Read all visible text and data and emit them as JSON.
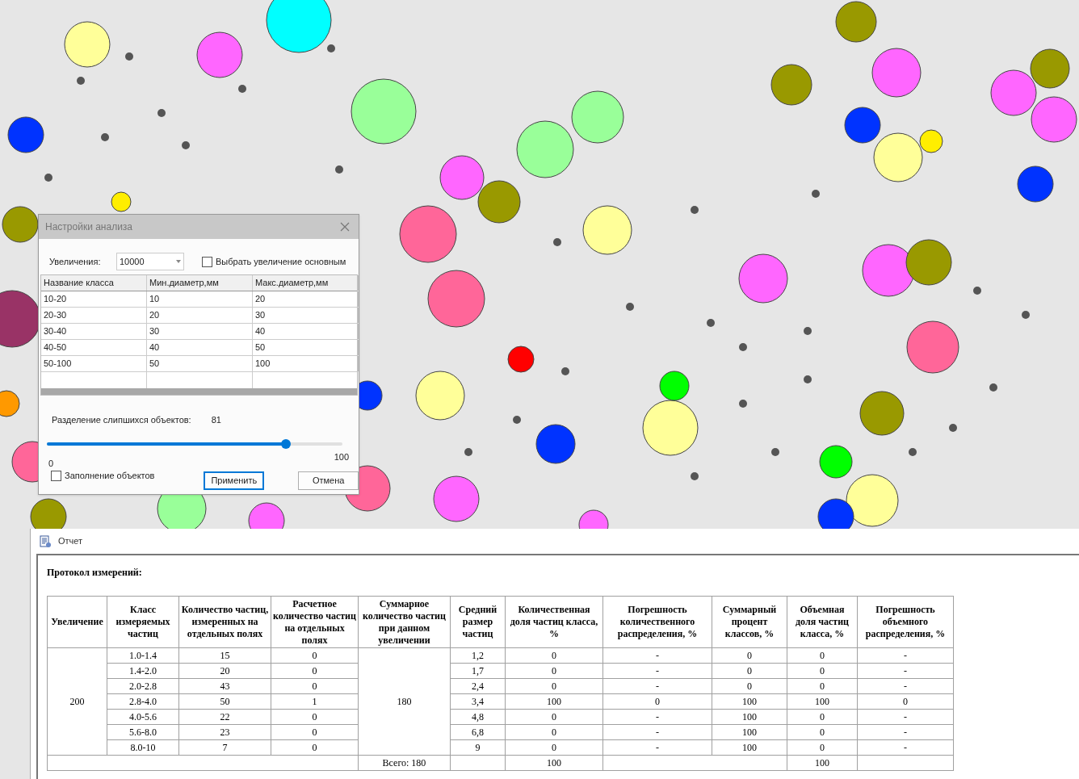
{
  "dialog": {
    "title": "Настройки анализа",
    "magnification_label": "Увеличения:",
    "magnification_value": "10000",
    "main_checkbox": {
      "label": "Выбрать увеличение основным",
      "checked": false
    },
    "class_table": {
      "columns": [
        "Название класса",
        "Мин.диаметр,мм",
        "Макс.диаметр,мм"
      ],
      "rows": [
        [
          "10-20",
          "10",
          "20"
        ],
        [
          "20-30",
          "20",
          "30"
        ],
        [
          "30-40",
          "30",
          "40"
        ],
        [
          "40-50",
          "40",
          "50"
        ],
        [
          "50-100",
          "50",
          "100"
        ]
      ]
    },
    "separation": {
      "label": "Разделение слипшихся объектов:",
      "reading": "81",
      "level": 0.81,
      "min": "0",
      "max": "100"
    },
    "fill_checkbox": {
      "label": "Заполнение объектов",
      "checked": false
    },
    "buttons": [
      {
        "label": "Применить",
        "default": true
      },
      {
        "label": "Отмена",
        "default": false
      }
    ]
  },
  "report": {
    "title": "Отчет",
    "heading": "Протокол измерений:",
    "columns": [
      "Увеличение",
      "Класс измеряемых частиц",
      "Количество частиц, измеренных на отдельных полях",
      "Расчетное количество частиц на отдельных полях",
      "Суммарное количество частиц при данном увеличении",
      "Средний размер частиц",
      "Количественная доля частиц класса, %",
      "Погрешность количественного распределения, %",
      "Суммарный процент классов, %",
      "Объемная доля частиц класса, %",
      "Погрешность объемного распределения, %"
    ],
    "magnification": "200",
    "total_count": "180",
    "rows": [
      {
        "class": "1.0-1.4",
        "measured": "15",
        "computed": "0",
        "mean_size": "1,2",
        "count_share": "0",
        "count_error": "-",
        "cumulative": "0",
        "volume_share": "0",
        "volume_error": "-"
      },
      {
        "class": "1.4-2.0",
        "measured": "20",
        "computed": "0",
        "mean_size": "1,7",
        "count_share": "0",
        "count_error": "-",
        "cumulative": "0",
        "volume_share": "0",
        "volume_error": "-"
      },
      {
        "class": "2.0-2.8",
        "measured": "43",
        "computed": "0",
        "mean_size": "2,4",
        "count_share": "0",
        "count_error": "-",
        "cumulative": "0",
        "volume_share": "0",
        "volume_error": "-"
      },
      {
        "class": "2.8-4.0",
        "measured": "50",
        "computed": "1",
        "mean_size": "3,4",
        "count_share": "100",
        "count_error": "0",
        "cumulative": "100",
        "volume_share": "100",
        "volume_error": "0"
      },
      {
        "class": "4.0-5.6",
        "measured": "22",
        "computed": "0",
        "mean_size": "4,8",
        "count_share": "0",
        "count_error": "-",
        "cumulative": "100",
        "volume_share": "0",
        "volume_error": "-"
      },
      {
        "class": "5.6-8.0",
        "measured": "23",
        "computed": "0",
        "mean_size": "6,8",
        "count_share": "0",
        "count_error": "-",
        "cumulative": "100",
        "volume_share": "0",
        "volume_error": "-"
      },
      {
        "class": "8.0-10",
        "measured": "7",
        "computed": "0",
        "mean_size": "9",
        "count_share": "0",
        "count_error": "-",
        "cumulative": "100",
        "volume_share": "0",
        "volume_error": "-"
      }
    ],
    "totals": {
      "total_count": "Всего: 180",
      "count_share": "100",
      "volume_share": "100"
    }
  }
}
